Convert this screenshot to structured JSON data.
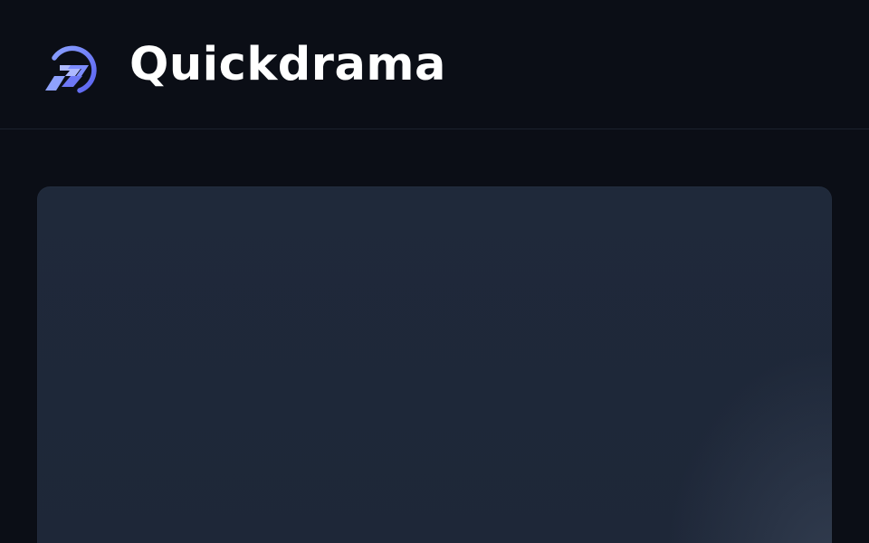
{
  "header": {
    "brand_name": "Quickdrama",
    "logo_icon": "quickdrama-logo-icon"
  },
  "colors": {
    "background": "#0b0e16",
    "card": "#1f293a",
    "logo_primary": "#6f7cff",
    "logo_secondary": "#8fa2ff",
    "brand_text": "#ffffff"
  }
}
